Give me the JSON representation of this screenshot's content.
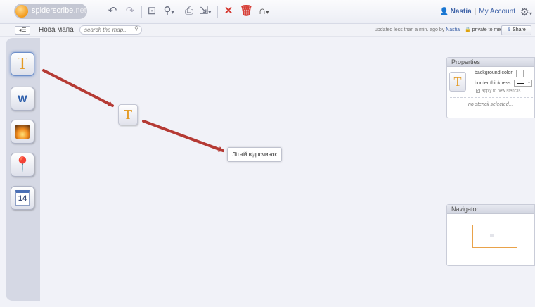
{
  "app": {
    "logo": {
      "name": "spiderscribe",
      "suffix": ".net"
    }
  },
  "toolbar": {
    "undo_icon": "undo-icon",
    "redo_icon": "redo-icon",
    "fit_icon": "fit-screen-icon",
    "zoom_icon": "zoom-icon",
    "print_icon": "print-icon",
    "export_icon": "export-icon",
    "delete_icon": "delete-icon",
    "trash_icon": "trash-icon",
    "magnet_icon": "magnet-icon"
  },
  "user": {
    "name": "Nastia",
    "account_link": "My Account",
    "separator": "|"
  },
  "subbar": {
    "map_title": "Нова мапа",
    "search_placeholder": "search the map...",
    "status_prefix": "updated less than a min. ago by",
    "status_user": "Nastia",
    "privacy": "private to me",
    "share_label": "Share"
  },
  "sidebar": {
    "tools": [
      {
        "name": "text-stencil",
        "glyph": "T"
      },
      {
        "name": "document-stencil",
        "glyph": "W"
      },
      {
        "name": "image-stencil",
        "glyph": ""
      },
      {
        "name": "map-stencil",
        "glyph": ""
      },
      {
        "name": "calendar-stencil",
        "glyph": "14"
      }
    ]
  },
  "canvas": {
    "dragging_stencil_glyph": "T",
    "node_text": "Літній відпочинок",
    "arrow_color": "#b53a34"
  },
  "properties": {
    "title": "Properties",
    "thumb_glyph": "T",
    "background_color_label": "background color",
    "border_thickness_label": "border thickness",
    "apply_label": "apply to new stencils",
    "apply_checked": true,
    "no_selection": "no stencil selected..."
  },
  "navigator": {
    "title": "Navigator"
  },
  "colors": {
    "accent": "#3f63a8",
    "logo_orange": "#f39a1a",
    "danger": "#d63b33",
    "stencil_text": "#e39a24"
  }
}
